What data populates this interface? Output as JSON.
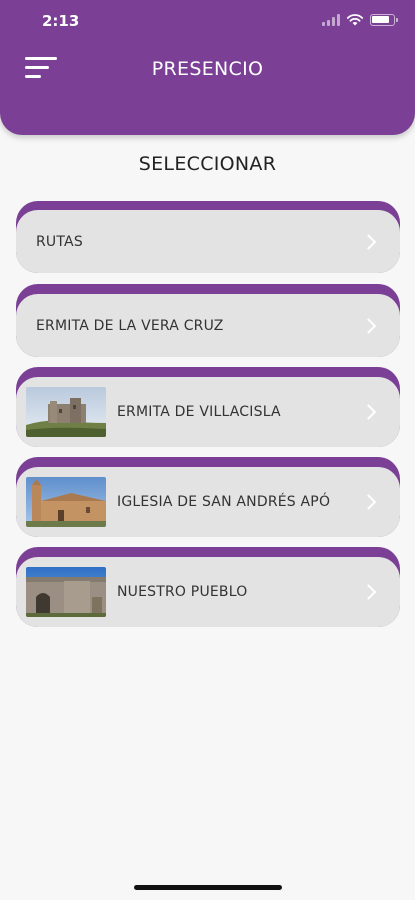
{
  "status_bar": {
    "time": "2:13"
  },
  "header": {
    "title": "PRESENCIO",
    "menu_icon": "hamburger-menu-icon"
  },
  "section_title": "SELECCIONAR",
  "colors": {
    "accent": "#7b4096",
    "card_bg": "#e3e3e3",
    "page_bg": "#f7f7f7"
  },
  "items": [
    {
      "label": "RUTAS"
    },
    {
      "label": "ERMITA DE LA VERA CRUZ"
    },
    {
      "label": "ERMITA DE VILLACISLA",
      "thumbnail": "castle-photo"
    },
    {
      "label": "IGLESIA DE SAN ANDRÉS APÓ",
      "thumbnail": "church-photo"
    },
    {
      "label": "NUESTRO PUEBLO",
      "thumbnail": "town-gate-photo"
    }
  ]
}
